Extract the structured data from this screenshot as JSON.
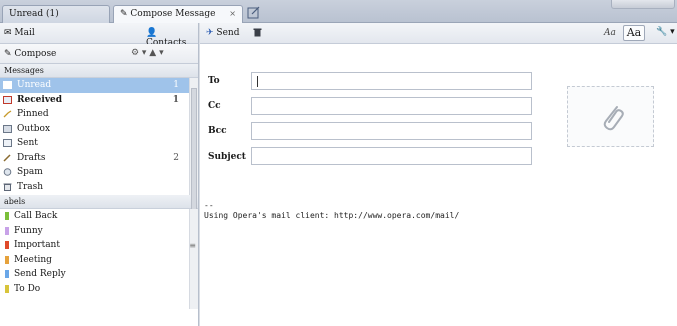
{
  "tabs": [
    {
      "label": "Unread (1)",
      "active": false
    },
    {
      "label": "Compose Message",
      "active": true,
      "close": "×"
    }
  ],
  "left_toolbar": {
    "mail": "Mail",
    "contacts": "Contacts",
    "compose": "Compose",
    "actions": "⚙ ▾  ▲ ▾"
  },
  "messages": {
    "header": "Messages",
    "items": [
      {
        "label": "Unread",
        "count": "1",
        "selected": true,
        "bold": false
      },
      {
        "label": "Received",
        "count": "1",
        "selected": false,
        "bold": true
      },
      {
        "label": "Pinned",
        "count": "",
        "selected": false,
        "bold": false
      },
      {
        "label": "Outbox",
        "count": "",
        "selected": false,
        "bold": false
      },
      {
        "label": "Sent",
        "count": "",
        "selected": false,
        "bold": false
      },
      {
        "label": "Drafts",
        "count": "2",
        "selected": false,
        "bold": false
      },
      {
        "label": "Spam",
        "count": "",
        "selected": false,
        "bold": false
      },
      {
        "label": "Trash",
        "count": "",
        "selected": false,
        "bold": false
      }
    ]
  },
  "labels": {
    "header": "abels",
    "items": [
      {
        "label": "Call Back",
        "color": "#7bbf3a"
      },
      {
        "label": "Funny",
        "color": "#c8a2e8"
      },
      {
        "label": "Important",
        "color": "#e04a2a"
      },
      {
        "label": "Meeting",
        "color": "#e6a23c"
      },
      {
        "label": "Send Reply",
        "color": "#6aa7e8"
      },
      {
        "label": "To Do",
        "color": "#d8c43a"
      }
    ]
  },
  "compose_toolbar": {
    "send": "Send",
    "font_small": "Aa",
    "font_large": "Aa"
  },
  "fields": {
    "to": {
      "label": "To",
      "value": ""
    },
    "cc": {
      "label": "Cc",
      "value": ""
    },
    "bcc": {
      "label": "Bcc",
      "value": ""
    },
    "subject": {
      "label": "Subject",
      "value": ""
    }
  },
  "message_body": {
    "signature": "--\nUsing Opera's mail client: http://www.opera.com/mail/"
  },
  "colors": {
    "selection": "#9fc3ea",
    "tab_bg": "#c9d0dc",
    "accent_blue": "#2f5fb3"
  }
}
